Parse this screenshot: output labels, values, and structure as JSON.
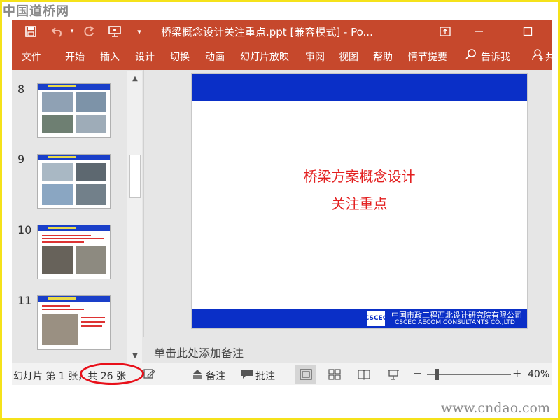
{
  "watermark_top": "中国道桥网",
  "watermark_bottom": "www.cndao.com",
  "window": {
    "title": "桥梁概念设计关注重点.ppt [兼容模式]  -  Po..."
  },
  "quick_access": {
    "save_icon": "save-icon",
    "undo_icon": "undo-icon",
    "redo_icon": "redo-icon",
    "present_icon": "present-icon",
    "customize_icon": "chevron-down-icon"
  },
  "ribbon": {
    "tabs": [
      "文件",
      "开始",
      "插入",
      "设计",
      "切换",
      "动画",
      "幻灯片放映",
      "审阅",
      "视图",
      "帮助",
      "情节提要"
    ],
    "tell_me": "告诉我",
    "share_glyph": "共"
  },
  "thumbnails": [
    {
      "num": "8"
    },
    {
      "num": "9"
    },
    {
      "num": "10"
    },
    {
      "num": "11"
    }
  ],
  "slide": {
    "line1": "桥梁方案概念设计",
    "line2": "关注重点",
    "logo_text": "CSCEC",
    "company_cn": "中国市政工程西北设计研究院有限公司",
    "company_en": "CSCEC AECOM CONSULTANTS CO.,LTD"
  },
  "notes": {
    "placeholder": "单击此处添加备注"
  },
  "status": {
    "slide_info": "幻灯片 第 1 张，共 26 张",
    "notes_btn": "备注",
    "comments_btn": "批注",
    "zoom_minus": "−",
    "zoom_plus": "+",
    "zoom_level": "40%"
  },
  "colors": {
    "accent": "#c6482c",
    "slide_blue": "#0a2fc7",
    "slide_red": "#e32020",
    "highlight": "#e8101a"
  }
}
